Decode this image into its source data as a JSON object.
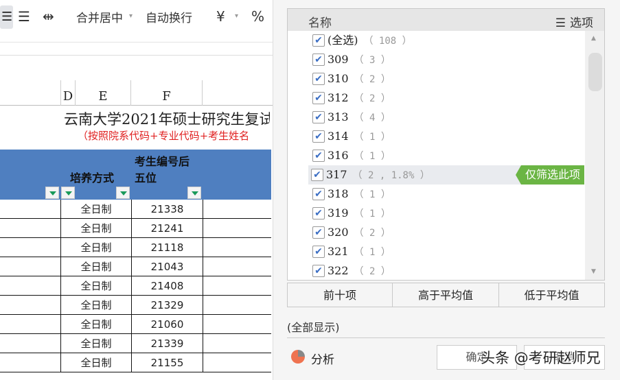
{
  "ribbon": {
    "merge_center": "合并居中",
    "wrap_text": "自动换行",
    "currency": "¥",
    "percent": "%"
  },
  "columns": {
    "d": "D",
    "e": "E",
    "f": "F"
  },
  "sheet": {
    "title": "云南大学2021年硕士研究生复试",
    "subtitle": "（按照院系代码+专业代码+考生姓名"
  },
  "table_header": {
    "training_mode": "培养方式",
    "exam_id_line1": "考生编号后",
    "exam_id_line2": "五位"
  },
  "rows": [
    {
      "mode": "全日制",
      "id": "21338"
    },
    {
      "mode": "全日制",
      "id": "21241"
    },
    {
      "mode": "全日制",
      "id": "21118"
    },
    {
      "mode": "全日制",
      "id": "21043"
    },
    {
      "mode": "全日制",
      "id": "21408"
    },
    {
      "mode": "全日制",
      "id": "21329"
    },
    {
      "mode": "全日制",
      "id": "21060"
    },
    {
      "mode": "全日制",
      "id": "21339"
    },
    {
      "mode": "全日制",
      "id": "21155"
    }
  ],
  "filter": {
    "header_name": "名称",
    "options_label": "选项",
    "items": [
      {
        "label": "(全选)",
        "count": "（ 108 ）"
      },
      {
        "label": "309",
        "count": "（ 3 ）"
      },
      {
        "label": "310",
        "count": "（ 2 ）"
      },
      {
        "label": "312",
        "count": "（ 2 ）"
      },
      {
        "label": "313",
        "count": "（ 4 ）"
      },
      {
        "label": "314",
        "count": "（ 1 ）"
      },
      {
        "label": "316",
        "count": "（ 1 ）"
      },
      {
        "label": "317",
        "count": "（ 2 , 1.8% ）"
      },
      {
        "label": "318",
        "count": "（ 1 ）"
      },
      {
        "label": "319",
        "count": "（ 1 ）"
      },
      {
        "label": "320",
        "count": "（ 2 ）"
      },
      {
        "label": "321",
        "count": "（ 1 ）"
      },
      {
        "label": "322",
        "count": "（ 2 ）"
      }
    ],
    "only_this": "仅筛选此项",
    "top10": "前十项",
    "above_avg": "高于平均值",
    "below_avg": "低于平均值",
    "show_all": "(全部显示)",
    "analyze": "分析",
    "ok": "确定",
    "cancel": "取消"
  },
  "watermark": "头条 @考研赵师兄"
}
